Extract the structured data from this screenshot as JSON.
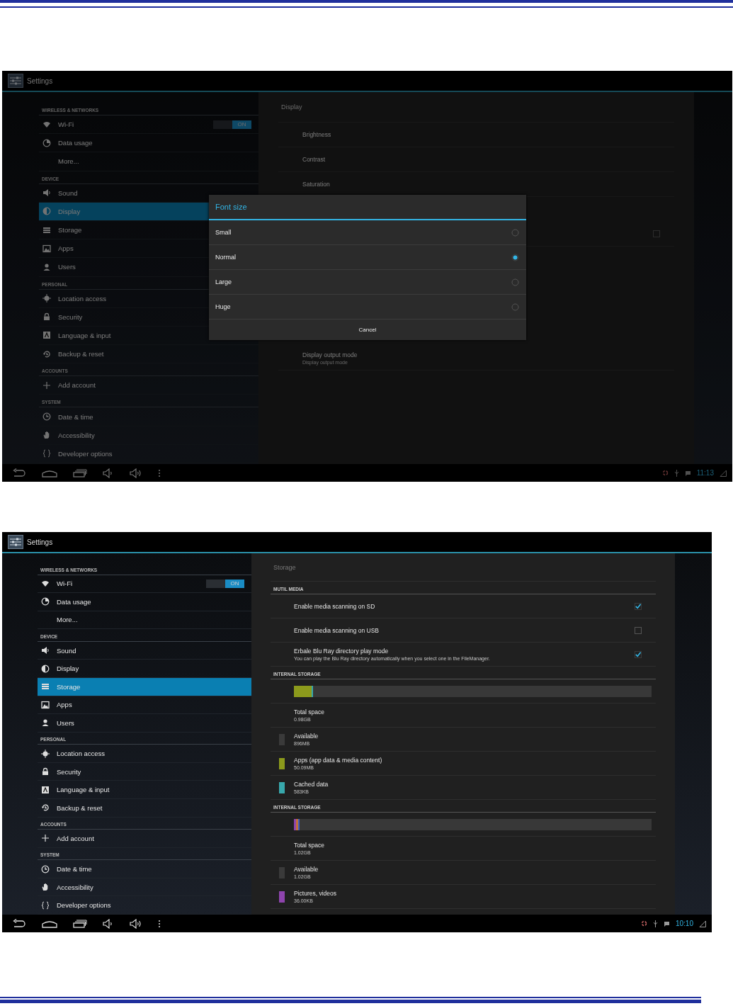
{
  "screens": [
    {
      "title": "Settings",
      "dimmed": true,
      "sidebar": {
        "sections": [
          {
            "heading": "WIRELESS & NETWORKS",
            "items": [
              {
                "label": "Wi-Fi",
                "selected": false,
                "toggle": {
                  "label": "ON",
                  "on": true
                }
              },
              {
                "label": "Data usage",
                "selected": false
              },
              {
                "label": "More...",
                "selected": false
              }
            ]
          },
          {
            "heading": "DEVICE",
            "items": [
              {
                "label": "Sound",
                "selected": false
              },
              {
                "label": "Display",
                "selected": true
              },
              {
                "label": "Storage",
                "selected": false
              },
              {
                "label": "Apps",
                "selected": false
              },
              {
                "label": "Users",
                "selected": false
              }
            ]
          },
          {
            "heading": "PERSONAL",
            "items": [
              {
                "label": "Location access",
                "selected": false
              },
              {
                "label": "Security",
                "selected": false
              },
              {
                "label": "Language & input",
                "selected": false
              },
              {
                "label": "Backup & reset",
                "selected": false
              }
            ]
          },
          {
            "heading": "ACCOUNTS",
            "items": [
              {
                "label": "Add account",
                "selected": false
              }
            ]
          },
          {
            "heading": "SYSTEM",
            "items": [
              {
                "label": "Date & time",
                "selected": false
              },
              {
                "label": "Accessibility",
                "selected": false
              },
              {
                "label": "Developer options",
                "selected": false
              }
            ]
          }
        ]
      },
      "pane": {
        "heading": "Display",
        "sections": [
          {
            "rows": [
              {
                "kind": "plain",
                "title": "Brightness"
              },
              {
                "kind": "plain",
                "title": "Contrast"
              },
              {
                "kind": "plain",
                "title": "Saturation"
              },
              {
                "kind": "checkbox",
                "checked": false
              },
              {
                "kind": "plain",
                "title": "Display output mode",
                "summary": "Display output mode"
              }
            ]
          }
        ]
      },
      "dialog": {
        "title": "Font size",
        "options": [
          {
            "label": "Small",
            "selected": false
          },
          {
            "label": "Normal",
            "selected": true
          },
          {
            "label": "Large",
            "selected": false
          },
          {
            "label": "Huge",
            "selected": false
          }
        ],
        "button": "Cancel"
      },
      "status": {
        "time": "11:13"
      }
    },
    {
      "title": "Settings",
      "dimmed": false,
      "sidebar": {
        "sections": [
          {
            "heading": "WIRELESS & NETWORKS",
            "items": [
              {
                "label": "Wi-Fi",
                "selected": false,
                "toggle": {
                  "label": "ON",
                  "on": true
                }
              },
              {
                "label": "Data usage",
                "selected": false
              },
              {
                "label": "More...",
                "selected": false
              }
            ]
          },
          {
            "heading": "DEVICE",
            "items": [
              {
                "label": "Sound",
                "selected": false
              },
              {
                "label": "Display",
                "selected": false
              },
              {
                "label": "Storage",
                "selected": true
              },
              {
                "label": "Apps",
                "selected": false
              },
              {
                "label": "Users",
                "selected": false
              }
            ]
          },
          {
            "heading": "PERSONAL",
            "items": [
              {
                "label": "Location access",
                "selected": false
              },
              {
                "label": "Security",
                "selected": false
              },
              {
                "label": "Language & input",
                "selected": false
              },
              {
                "label": "Backup & reset",
                "selected": false
              }
            ]
          },
          {
            "heading": "ACCOUNTS",
            "items": [
              {
                "label": "Add account",
                "selected": false
              }
            ]
          },
          {
            "heading": "SYSTEM",
            "items": [
              {
                "label": "Date & time",
                "selected": false
              },
              {
                "label": "Accessibility",
                "selected": false
              },
              {
                "label": "Developer options",
                "selected": false
              }
            ]
          }
        ]
      },
      "pane": {
        "heading": "Storage",
        "sections": [
          {
            "heading": "MUTIL MEDIA",
            "rows": [
              {
                "kind": "checkbox",
                "title": "Enable media scanning on SD",
                "checked": true
              },
              {
                "kind": "checkbox",
                "title": "Enable media scanning on USB",
                "checked": false
              },
              {
                "kind": "checkbox",
                "title": "Erbale Blu Ray directory play mode",
                "summary": "You can play the Blu Ray directory automatically when you select one in the FileManager.",
                "checked": true
              }
            ]
          },
          {
            "heading": "INTERNAL STORAGE",
            "rows": [
              {
                "kind": "bar",
                "segments": [
                  {
                    "level": 0.05,
                    "color": "#8c9a1c"
                  },
                  {
                    "level": 0.004,
                    "color": "#38a8ac"
                  }
                ]
              },
              {
                "kind": "stat",
                "title": "Total space",
                "summary": "0.98GB"
              },
              {
                "kind": "stat",
                "title": "Available",
                "summary": "896MB",
                "color": "#3a3a3a"
              },
              {
                "kind": "stat",
                "title": "Apps (app data & media content)",
                "summary": "50.09MB",
                "color": "#8c9a1c"
              },
              {
                "kind": "stat",
                "title": "Cached data",
                "summary": "583KB",
                "color": "#38a8ac"
              }
            ]
          },
          {
            "heading": "INTERNAL STORAGE",
            "rows": [
              {
                "kind": "bar",
                "segments": [
                  {
                    "level": 0.006,
                    "color": "#8e44ad"
                  },
                  {
                    "level": 0.005,
                    "color": "#c0703a"
                  },
                  {
                    "level": 0.005,
                    "color": "#4060c0"
                  }
                ]
              },
              {
                "kind": "stat",
                "title": "Total space",
                "summary": "1.02GB"
              },
              {
                "kind": "stat",
                "title": "Available",
                "summary": "1.02GB",
                "color": "#3a3a3a"
              },
              {
                "kind": "stat",
                "title": "Pictures, videos",
                "summary": "36.00KB",
                "color": "#8e44ad"
              }
            ]
          }
        ]
      },
      "status": {
        "time": "10:10"
      }
    }
  ]
}
